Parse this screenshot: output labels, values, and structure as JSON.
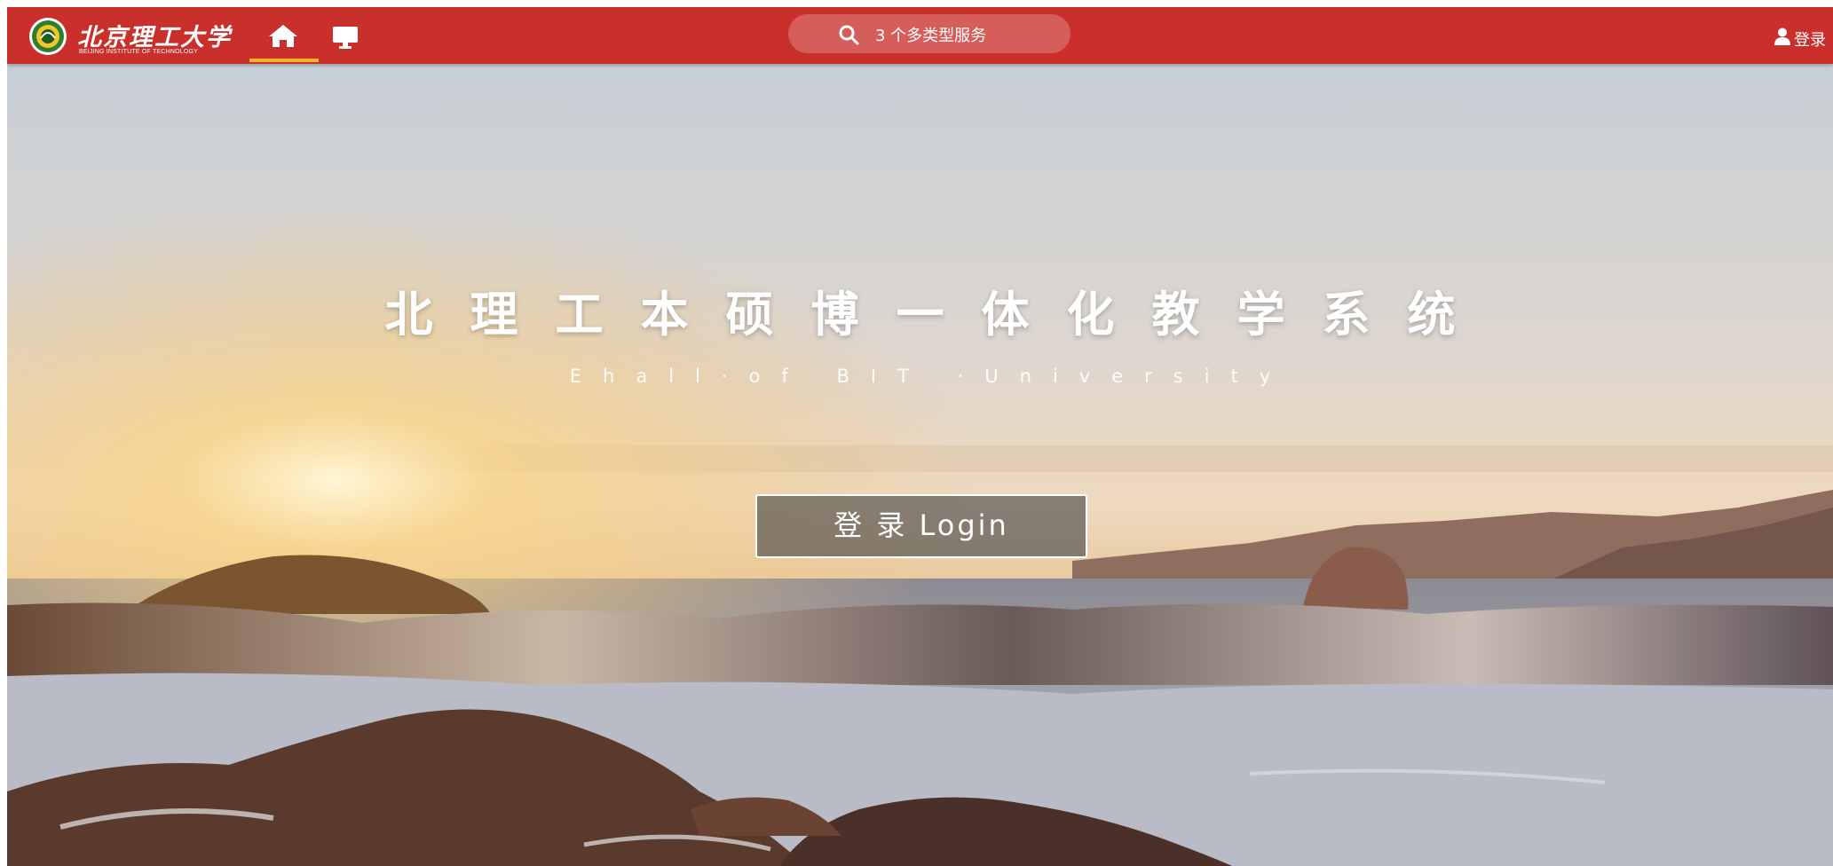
{
  "navbar": {
    "logo_cn": "北京理工大学",
    "logo_en": "BEIJING INSTITUTE OF TECHNOLOGY",
    "search_text": "3 个多类型服务",
    "login_label": "登录",
    "bg_color": "#c9302c",
    "active_underline_color": "#f0b429",
    "home_icon": "home-icon",
    "monitor_icon": "monitor-icon",
    "search_icon": "search-icon",
    "user_icon": "user-icon"
  },
  "hero": {
    "title": "北理工本硕博一体化教学系统",
    "subtitle": "Ehall·of BIT ·University",
    "login_button": "登 录  Login"
  }
}
